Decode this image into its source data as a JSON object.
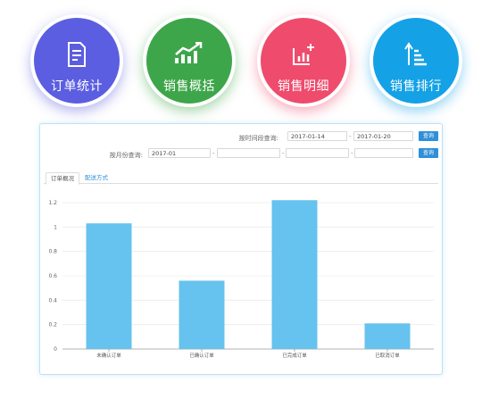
{
  "nav": [
    {
      "label": "订单统计",
      "icon": "document-icon",
      "color": "#5b5ee0"
    },
    {
      "label": "销售概括",
      "icon": "trend-chart-icon",
      "color": "#3ea64a"
    },
    {
      "label": "销售明细",
      "icon": "bar-chart-icon",
      "color": "#ef4b6c"
    },
    {
      "label": "销售排行",
      "icon": "ranking-icon",
      "color": "#14a1e6"
    }
  ],
  "filters": {
    "date_range_label": "按时间段查询:",
    "date_from": "2017-01-14",
    "date_to": "2017-01-20",
    "separator": "-",
    "query_button": "查询",
    "month_label": "按月份查询:",
    "month_values": [
      "2017-01",
      "",
      "",
      ""
    ],
    "month_query_button": "查询"
  },
  "tabs": [
    {
      "label": "订单概况",
      "active": true
    },
    {
      "label": "配送方式",
      "active": false
    }
  ],
  "chart_data": {
    "type": "bar",
    "categories": [
      "未确认订单",
      "已确认订单",
      "已完成订单",
      "已取消订单"
    ],
    "values": [
      1.03,
      0.56,
      1.22,
      0.21
    ],
    "ylim": [
      0,
      1.2
    ],
    "yticks": [
      0,
      0.2,
      0.4,
      0.6,
      0.8,
      1,
      1.2
    ],
    "grid": true,
    "bar_color": "#66c2ee"
  }
}
